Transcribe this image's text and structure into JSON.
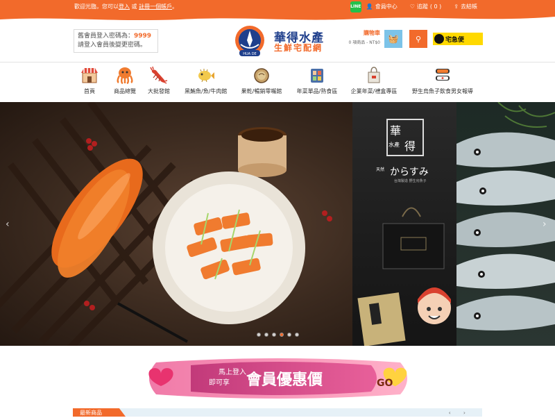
{
  "topbar": {
    "welcome_prefix": "歡迎光臨，您可以",
    "login_link": "登入",
    "or": " 或 ",
    "register_link": "註冊一個帳戶",
    "welcome_suffix": "。",
    "line_label": "LINE",
    "member_center": "會員中心",
    "tracking": "追蹤",
    "tracking_count": "( 0 )",
    "checkout": "去結帳"
  },
  "header": {
    "password_note_line1": "舊會員登入密碼為：",
    "password_code": "9999",
    "password_note_line2": "請登入會員後變更密碼。",
    "logo_en": "HUA DE",
    "logo_name": "華得水產",
    "logo_tagline": "生鮮宅配網",
    "cart_label": "購物車",
    "cart_summary": "0 項商品 - NT$0",
    "delivery_logo": "宅急便"
  },
  "nav": {
    "items": [
      {
        "label": "首頁",
        "icon": "shop-icon"
      },
      {
        "label": "商品總覽",
        "icon": "octopus-icon"
      },
      {
        "label": "大批發館",
        "icon": "lobster-icon"
      },
      {
        "label": "黑鮪魚/魚/牛肉館",
        "icon": "pufferfish-icon"
      },
      {
        "label": "果乾/暢銷零嘴館",
        "icon": "pan-icon"
      },
      {
        "label": "年菜單品/熟食區",
        "icon": "tray-icon"
      },
      {
        "label": "企業年菜/禮盒專區",
        "icon": "gift-bag-icon"
      },
      {
        "label": "野生烏魚子飲食男女報導",
        "icon": "sushi-icon"
      }
    ]
  },
  "banner": {
    "brand_big": "華",
    "brand_small": "水產",
    "brand_big2": "得",
    "slogan_prefix": "天然",
    "slogan": "からすみ",
    "subtitle": "台灣製造 野生烏魚子",
    "slides": 6,
    "active_slide": 3
  },
  "promo": {
    "line1": "馬上登入",
    "line2": "即可享",
    "headline": "會員優惠價",
    "go": "GO"
  },
  "section": {
    "title": "最新商品",
    "prev": "‹",
    "next": "›"
  },
  "colors": {
    "accent": "#f26a2b",
    "navy": "#1f3f8c",
    "line_green": "#22c04a",
    "cart_blue": "#7cc3e8",
    "yamato_yellow": "#ffd900"
  }
}
